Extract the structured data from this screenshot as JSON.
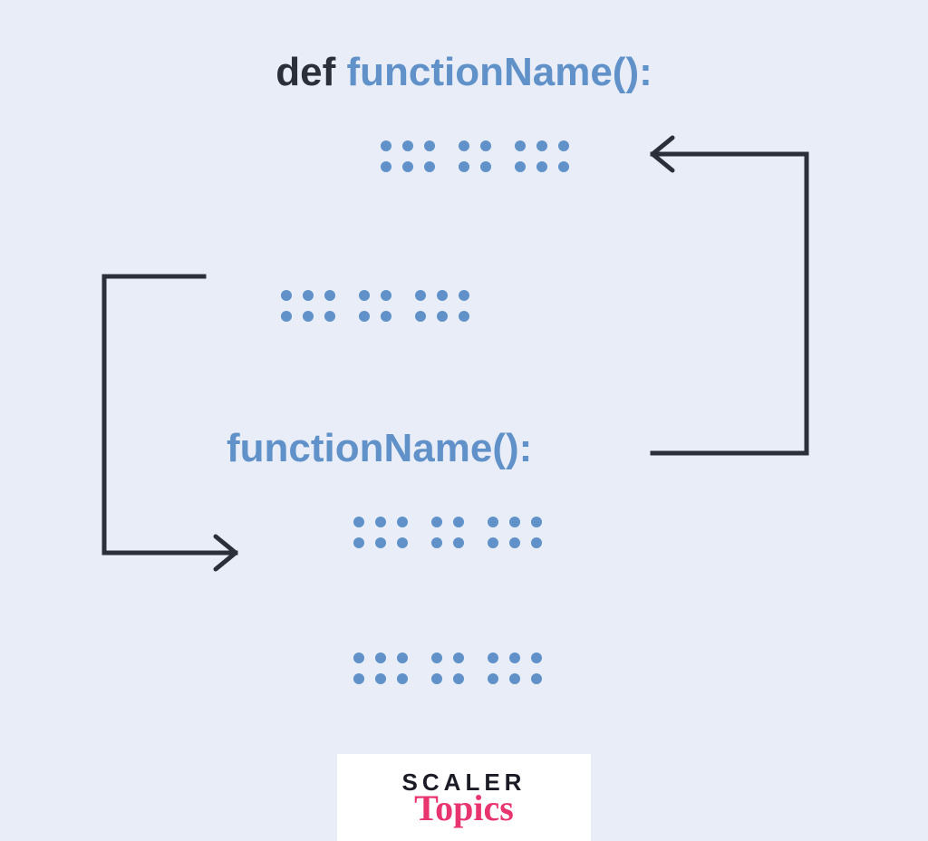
{
  "title": {
    "def_keyword": "def",
    "fn_name": "functionName():"
  },
  "call": {
    "fn_name": "functionName():"
  },
  "logo": {
    "line1": "SCALER",
    "line2": "Topics"
  },
  "colors": {
    "background": "#e8edf7",
    "keyword": "#2b2f3a",
    "identifier": "#6091c9",
    "arrow": "#2b2f3a",
    "logo_accent": "#e8356f"
  },
  "diagram": {
    "description": "Recursive function illustration: def functionName() calls functionName() within its own body, with arrows showing the recursion loop.",
    "dot_rows_count": 4,
    "arrows": [
      "recursive-call-arrow-right",
      "control-flow-arrow-left"
    ]
  }
}
